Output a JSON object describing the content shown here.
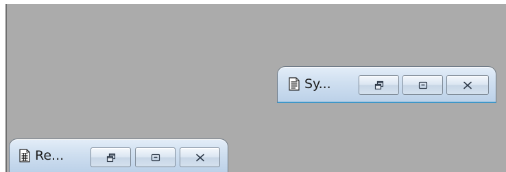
{
  "desktop": {
    "background_color": "#ababab"
  },
  "windows": [
    {
      "title": "Sy...",
      "icon": "document-icon",
      "buttons": [
        "restore-icon",
        "maximize-icon",
        "close-icon"
      ]
    },
    {
      "title": "Re...",
      "icon": "report-icon",
      "buttons": [
        "restore-icon",
        "maximize-icon",
        "close-icon"
      ]
    }
  ]
}
